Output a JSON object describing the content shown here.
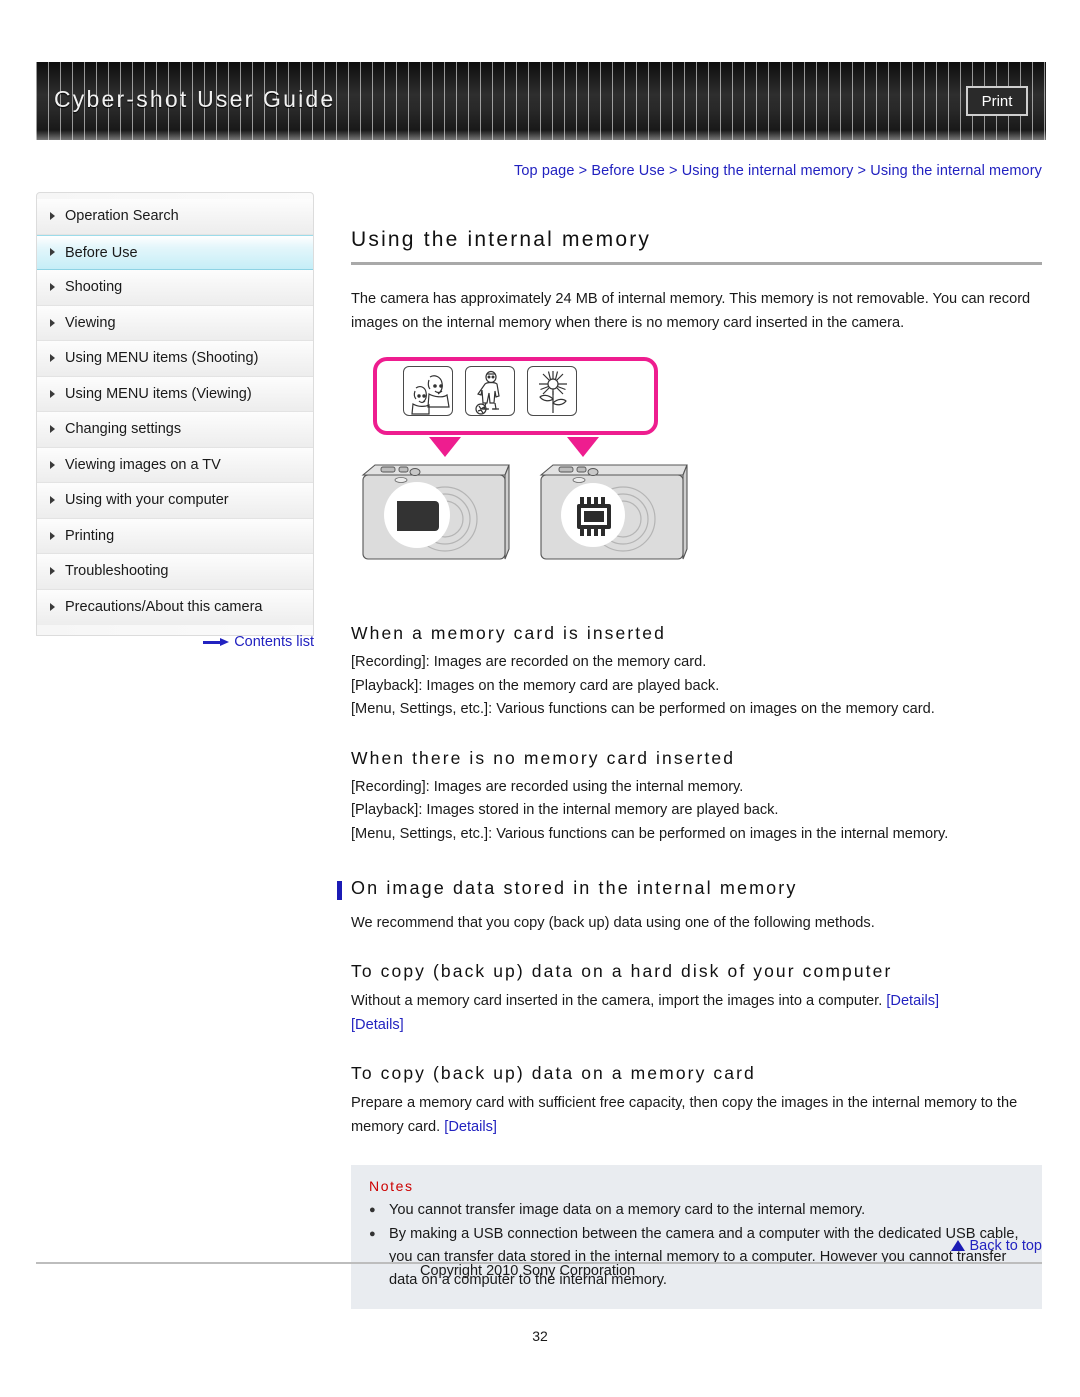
{
  "header": {
    "title": "Cyber-shot User Guide",
    "print_label": "Print"
  },
  "breadcrumb": {
    "text": "Top page > Before Use > Using the internal memory > Using the internal memory"
  },
  "sidebar": {
    "items": [
      {
        "label": "Operation Search",
        "active": false
      },
      {
        "label": "Before Use",
        "active": true
      },
      {
        "label": "Shooting",
        "active": false
      },
      {
        "label": "Viewing",
        "active": false
      },
      {
        "label": "Using MENU items (Shooting)",
        "active": false
      },
      {
        "label": "Using MENU items (Viewing)",
        "active": false
      },
      {
        "label": "Changing settings",
        "active": false
      },
      {
        "label": "Viewing images on a TV",
        "active": false
      },
      {
        "label": "Using with your computer",
        "active": false
      },
      {
        "label": "Printing",
        "active": false
      },
      {
        "label": "Troubleshooting",
        "active": false
      },
      {
        "label": "Precautions/About this camera",
        "active": false
      }
    ],
    "contents_link": "Contents list"
  },
  "main": {
    "page_title": "Using the internal memory",
    "intro": "The camera has approximately 24 MB of internal memory. This memory is not removable. You can record images on the internal memory when there is no memory card inserted in the camera.",
    "figure": {
      "thumbnails": [
        "two-people-photo-icon",
        "soccer-player-photo-icon",
        "flower-photo-icon"
      ],
      "left_camera_badge": "memory-card-icon",
      "right_camera_badge": "internal-memory-chip-icon",
      "callout_color": "#ee1d8f"
    },
    "section_card_inserted": {
      "heading": "When a memory card is inserted",
      "lines": [
        "[Recording]: Images are recorded on the memory card.",
        "[Playback]: Images on the memory card are played back.",
        "[Menu, Settings, etc.]: Various functions can be performed on images on the memory card."
      ]
    },
    "section_no_card": {
      "heading": "When there is no memory card inserted",
      "lines": [
        "[Recording]: Images are recorded using the internal memory.",
        "[Playback]: Images stored in the internal memory are played back.",
        "[Menu, Settings, etc.]: Various functions can be performed on images in the internal memory."
      ]
    },
    "section_stored_data": {
      "heading": "On image data stored in the internal memory",
      "intro": "We recommend that you copy (back up) data using one of the following methods.",
      "hard_disk": {
        "heading": "To copy (back up) data on a hard disk of your computer",
        "text": "Without a memory card inserted in the camera, import the images into a computer. ",
        "link_1": "[Details]",
        "link_2": "[Details]"
      },
      "memory_card": {
        "heading": "To copy (back up) data on a memory card",
        "text_before": "Prepare a memory card with sufficient free capacity, then copy the images in the internal memory to the memory card. ",
        "link": "[Details]"
      }
    },
    "notes": {
      "title": "Notes",
      "items": [
        "You cannot transfer image data on a memory card to the internal memory.",
        "By making a USB connection between the camera and a computer with the dedicated USB cable, you can transfer data stored in the internal memory to a computer. However you cannot transfer data on a computer to the internal memory."
      ]
    }
  },
  "footer": {
    "back_to_top": "Back to top",
    "copyright": "Copyright 2010 Sony Corporation",
    "page_number": "32"
  }
}
